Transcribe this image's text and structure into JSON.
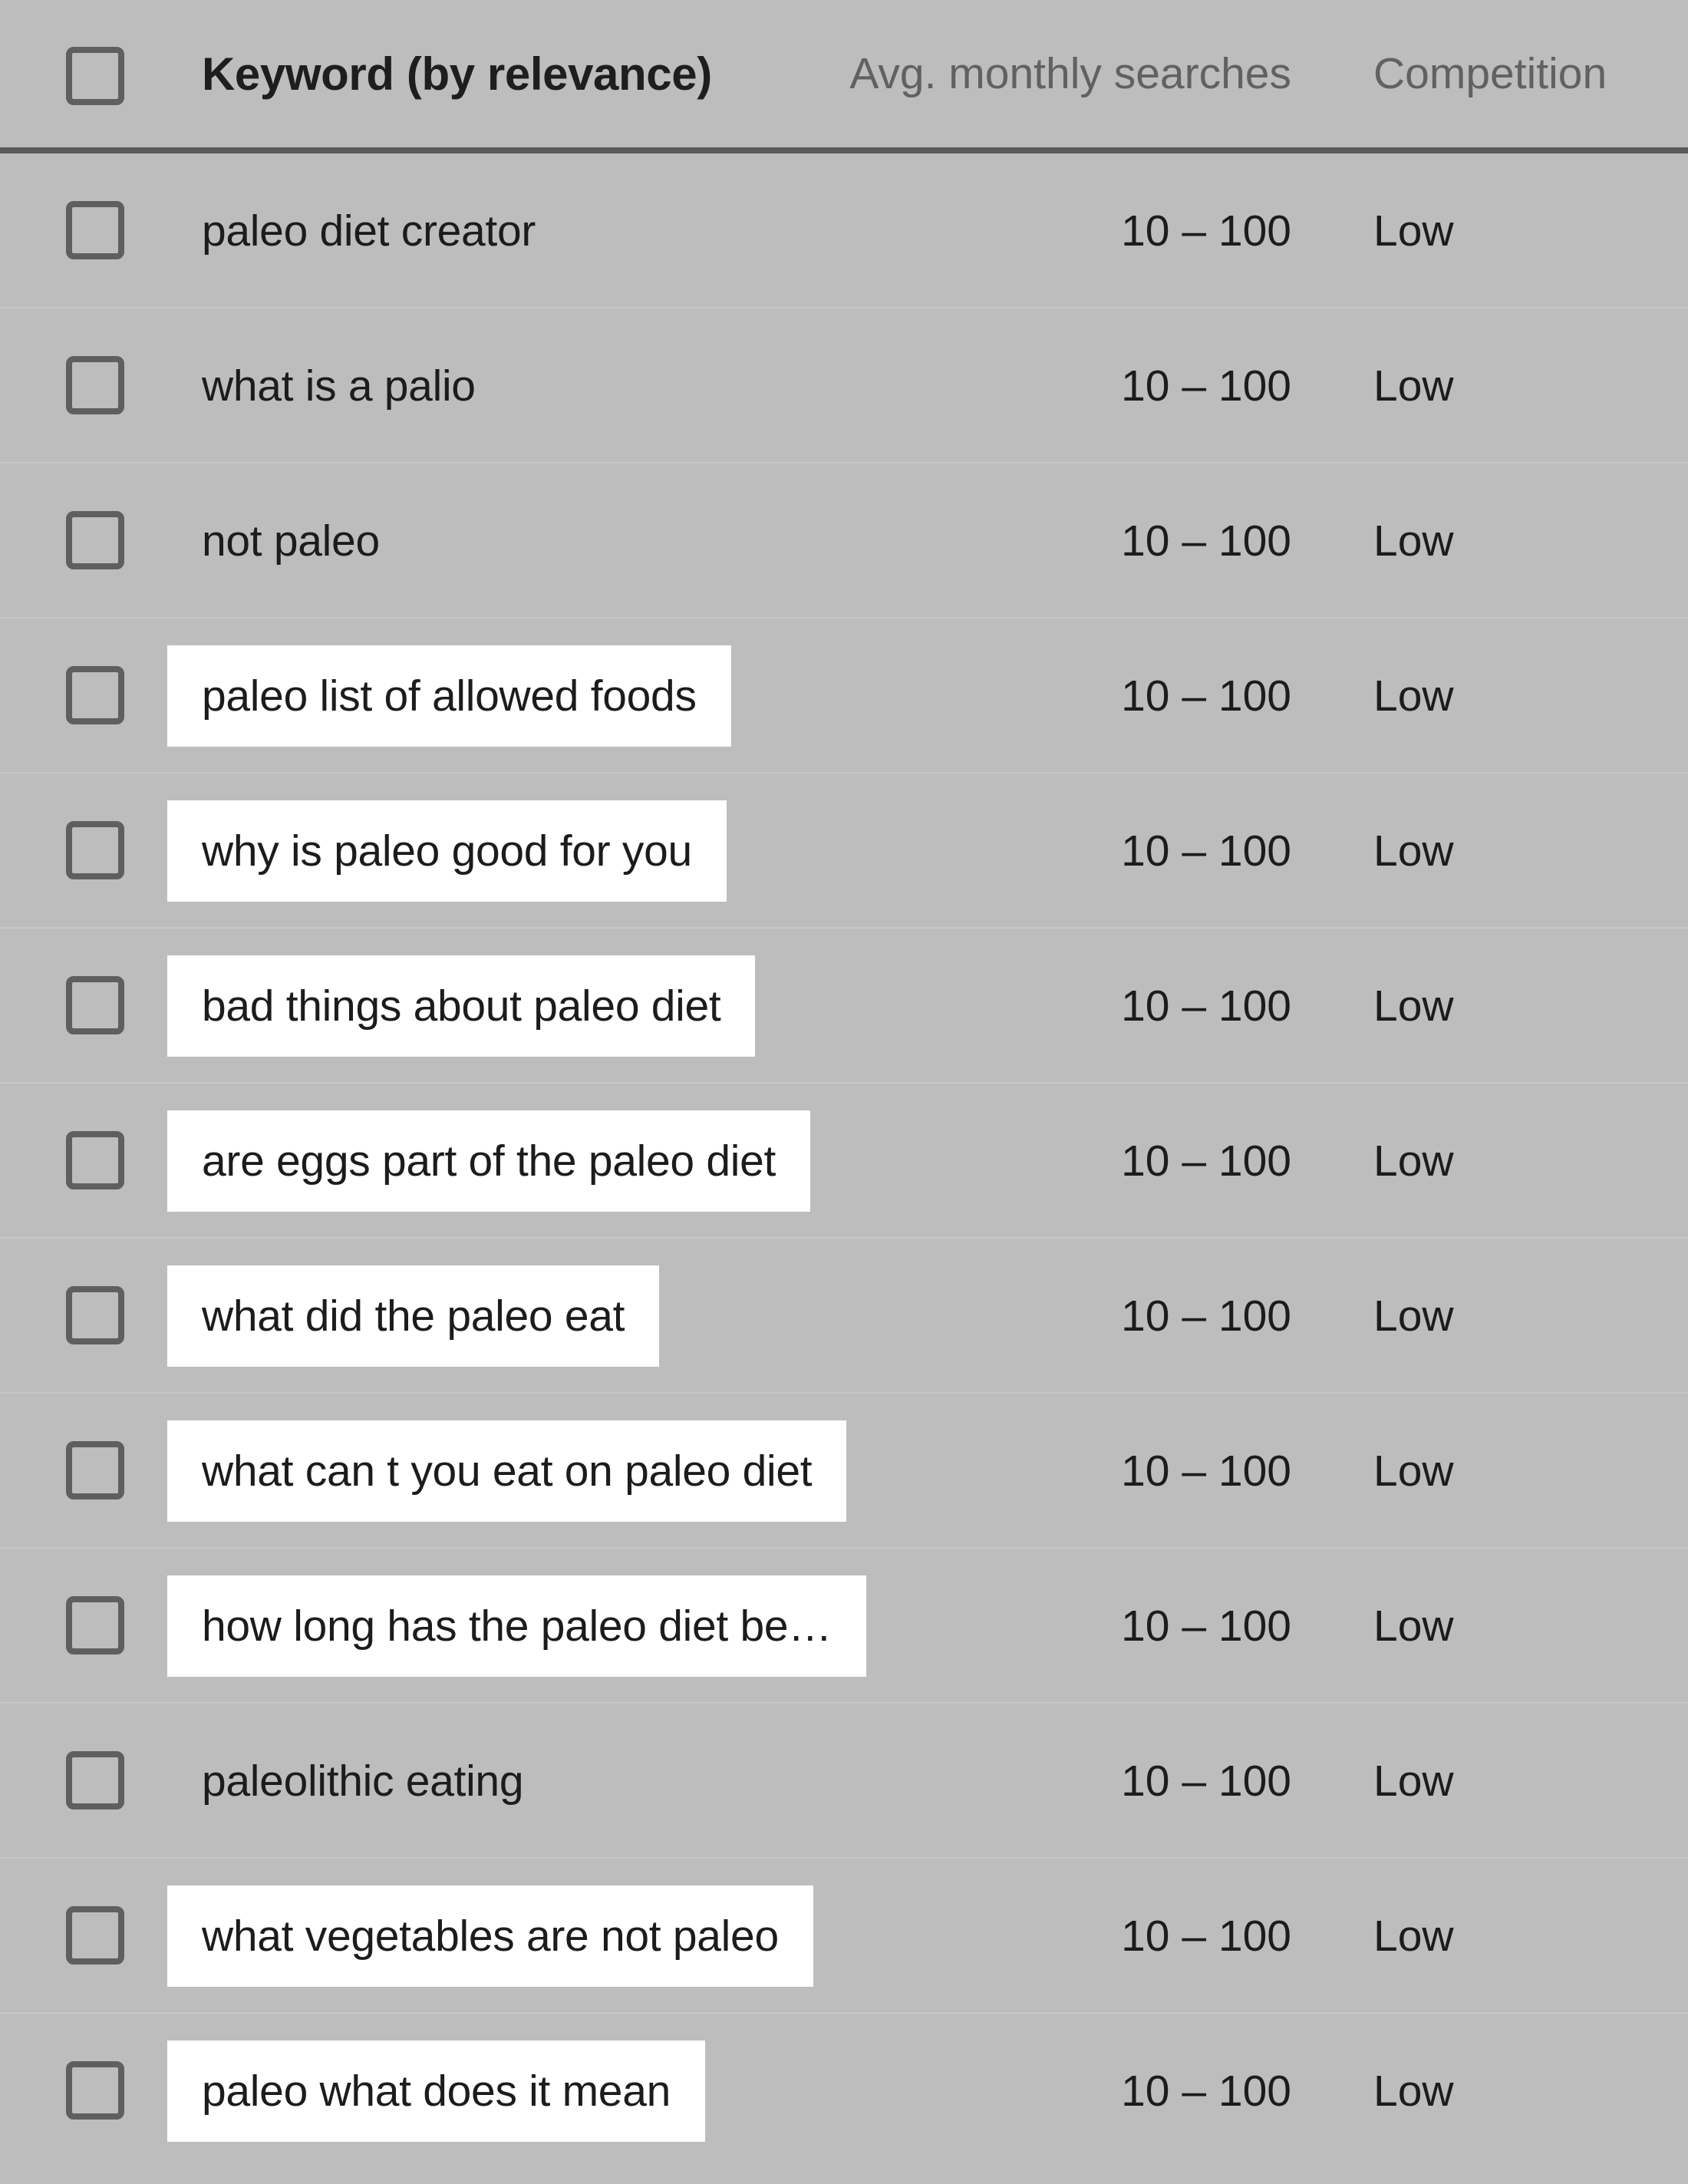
{
  "table": {
    "columns": {
      "keyword": "Keyword (by relevance)",
      "avg_monthly_searches": "Avg. monthly searches",
      "competition": "Competition"
    },
    "select_all_checkbox": "select-all-checkbox",
    "colors": {
      "background": "#bdbdbd",
      "highlight": "#ffffff",
      "header_rule": "#5a5a5a",
      "row_rule": "#c7c7c7",
      "text": "#1c1c1c",
      "header_muted_text": "#616161",
      "checkbox_border": "#5f5f5f"
    },
    "rows": [
      {
        "keyword": "paleo diet creator",
        "highlighted": false,
        "avg_monthly_searches": "10 – 100",
        "competition": "Low",
        "checked": false
      },
      {
        "keyword": "what is a palio",
        "highlighted": false,
        "avg_monthly_searches": "10 – 100",
        "competition": "Low",
        "checked": false
      },
      {
        "keyword": "not paleo",
        "highlighted": false,
        "avg_monthly_searches": "10 – 100",
        "competition": "Low",
        "checked": false
      },
      {
        "keyword": "paleo list of allowed foods",
        "highlighted": true,
        "avg_monthly_searches": "10 – 100",
        "competition": "Low",
        "checked": false
      },
      {
        "keyword": "why is paleo good for you",
        "highlighted": true,
        "avg_monthly_searches": "10 – 100",
        "competition": "Low",
        "checked": false
      },
      {
        "keyword": "bad things about paleo diet",
        "highlighted": true,
        "avg_monthly_searches": "10 – 100",
        "competition": "Low",
        "checked": false
      },
      {
        "keyword": "are eggs part of the paleo diet",
        "highlighted": true,
        "avg_monthly_searches": "10 – 100",
        "competition": "Low",
        "checked": false
      },
      {
        "keyword": "what did the paleo eat",
        "highlighted": true,
        "avg_monthly_searches": "10 – 100",
        "competition": "Low",
        "checked": false
      },
      {
        "keyword": "what can t you eat on paleo diet",
        "highlighted": true,
        "avg_monthly_searches": "10 – 100",
        "competition": "Low",
        "checked": false
      },
      {
        "keyword": "how long has the paleo diet be…",
        "highlighted": true,
        "avg_monthly_searches": "10 – 100",
        "competition": "Low",
        "checked": false
      },
      {
        "keyword": "paleolithic eating",
        "highlighted": false,
        "avg_monthly_searches": "10 – 100",
        "competition": "Low",
        "checked": false
      },
      {
        "keyword": "what vegetables are not paleo",
        "highlighted": true,
        "avg_monthly_searches": "10 – 100",
        "competition": "Low",
        "checked": false
      },
      {
        "keyword": "paleo what does it mean",
        "highlighted": true,
        "avg_monthly_searches": "10 – 100",
        "competition": "Low",
        "checked": false
      }
    ]
  }
}
